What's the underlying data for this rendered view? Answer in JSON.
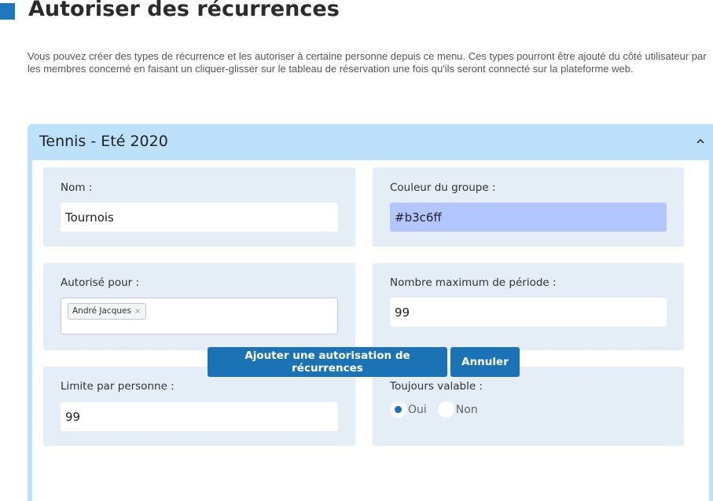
{
  "page": {
    "title": "Autoriser des récurrences",
    "description": "Vous pouvez créer des types de récurrence et les autoriser à certaine personne depuis ce menu. Ces types pourront être ajouté du côté utilisateur par les membres concerné en faisant un cliquer-glisser sur le tableau de réservation une fois qu'ils seront connecté sur la plateforme web."
  },
  "panel": {
    "title": "Tennis - Eté 2020",
    "collapse_icon": "chevron-up-icon"
  },
  "form": {
    "nom": {
      "label": "Nom :",
      "value": "Tournois"
    },
    "couleur": {
      "label": "Couleur du groupe :",
      "value": "#b3c6ff",
      "swatch": "#b3c6ff"
    },
    "autorise": {
      "label": "Autorisé pour :",
      "tags": [
        {
          "label": "André Jacques",
          "remove": "×"
        }
      ]
    },
    "max_periode": {
      "label": "Nombre maximum de période :",
      "value": "99"
    },
    "limite": {
      "label": "Limite par personne :",
      "value": "99"
    },
    "toujours": {
      "label": "Toujours valable :",
      "options": [
        {
          "label": "Oui",
          "checked": true
        },
        {
          "label": "Non",
          "checked": false
        }
      ]
    }
  },
  "actions": {
    "submit_label": "Ajouter une autorisation de récurrences",
    "cancel_label": "Annuler"
  },
  "colors": {
    "accent": "#1b72b4",
    "panel": "#bde1fb",
    "card": "#e5eef6"
  }
}
